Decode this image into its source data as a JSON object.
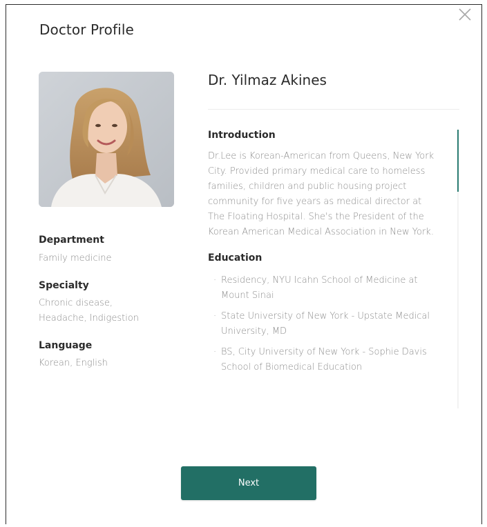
{
  "modal": {
    "title": "Doctor Profile",
    "close_icon": "close-icon"
  },
  "doctor": {
    "name": "Dr. Yilmaz Akines",
    "photo_icon": "doctor-portrait"
  },
  "details": {
    "department_label": "Department",
    "department_value": "Family medicine",
    "specialty_label": "Specialty",
    "specialty_value": "Chronic disease, Headache, Indigestion",
    "language_label": "Language",
    "language_value": "Korean, English"
  },
  "introduction": {
    "title": "Introduction",
    "text": "Dr.Lee is Korean-American from Queens, New York City. Provided primary medical care to homeless families, children and public housing project community for five years as medical director at The Floating Hospital. She's the President of the Korean American Medical Association in New York."
  },
  "education": {
    "title": "Education",
    "items": [
      "Residency, NYU Icahn School of Medicine at Mount Sinai",
      "State University of New York - Upstate Medical University, MD",
      "BS, City University of New York - Sophie Davis School of Biomedical Education"
    ]
  },
  "actions": {
    "next_label": "Next"
  },
  "colors": {
    "accent": "#226f65",
    "muted_text": "#8c8c8c",
    "text": "#2b2b2b"
  }
}
